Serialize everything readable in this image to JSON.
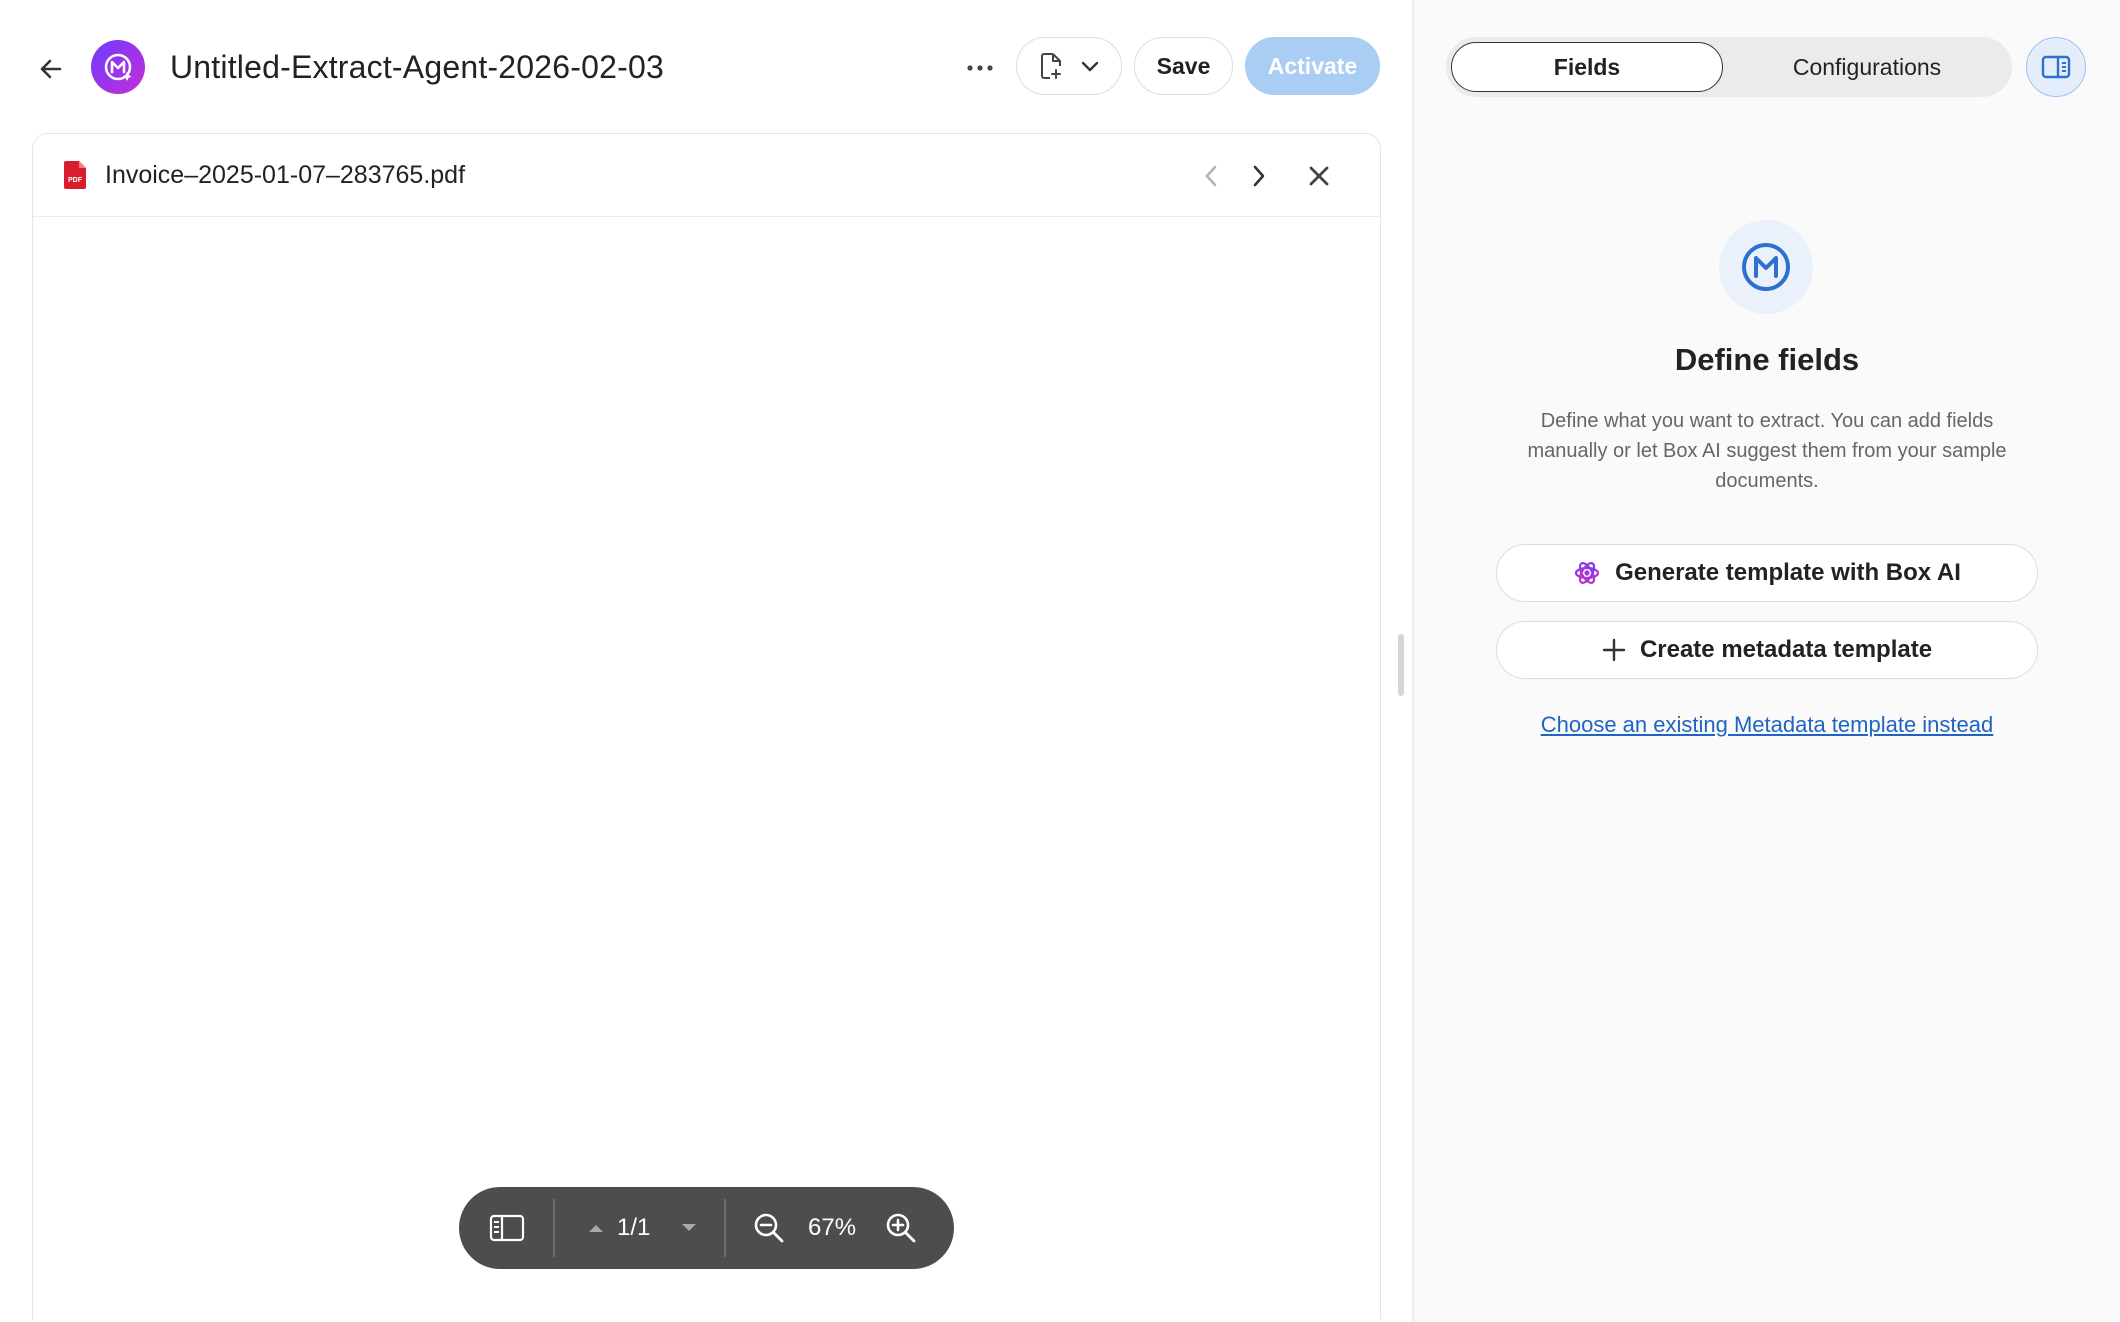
{
  "header": {
    "title": "Untitled-Extract-Agent-2026-02-03",
    "save_label": "Save",
    "activate_label": "Activate"
  },
  "viewer": {
    "file_name": "Invoice–2025-01-07–283765.pdf",
    "file_type_badge": "PDF",
    "page_indicator": "1/1",
    "zoom_level": "67%"
  },
  "right_panel": {
    "tabs": [
      {
        "label": "Fields",
        "selected": true
      },
      {
        "label": "Configurations",
        "selected": false
      }
    ],
    "empty_state": {
      "title": "Define fields",
      "description": "Define what you want to extract. You can add fields manually or let Box AI suggest them from your sample documents.",
      "generate_button": "Generate template with Box AI",
      "create_button": "Create metadata template",
      "choose_link": "Choose an existing Metadata template instead"
    }
  },
  "icons": {
    "back": "back-arrow-icon",
    "agent_logo": "metadata-agent-icon",
    "more": "more-horizontal-icon",
    "file_menu": "file-plus-icon",
    "chevron": "chevron-down-icon",
    "pdf": "pdf-file-icon",
    "prev": "chevron-left-icon",
    "next": "chevron-right-icon",
    "close": "close-icon",
    "sidebar_toggle": "sidebar-icon",
    "page_up": "caret-up-icon",
    "page_down": "caret-down-icon",
    "zoom_out": "zoom-out-icon",
    "zoom_in": "zoom-in-icon",
    "panel_toggle": "panel-toggle-icon",
    "metadata": "metadata-m-icon",
    "box_ai": "box-ai-sparkle-icon",
    "plus": "plus-icon"
  },
  "colors": {
    "accent_blue": "#2f6fd1",
    "activate_disabled": "#a9cdf3",
    "link": "#1f64c4",
    "logo_gradient_start": "#6d3cff",
    "logo_gradient_end": "#c52dd8",
    "pdf_red": "#d81e2c",
    "toolbar_bg": "#4d4d4d"
  }
}
